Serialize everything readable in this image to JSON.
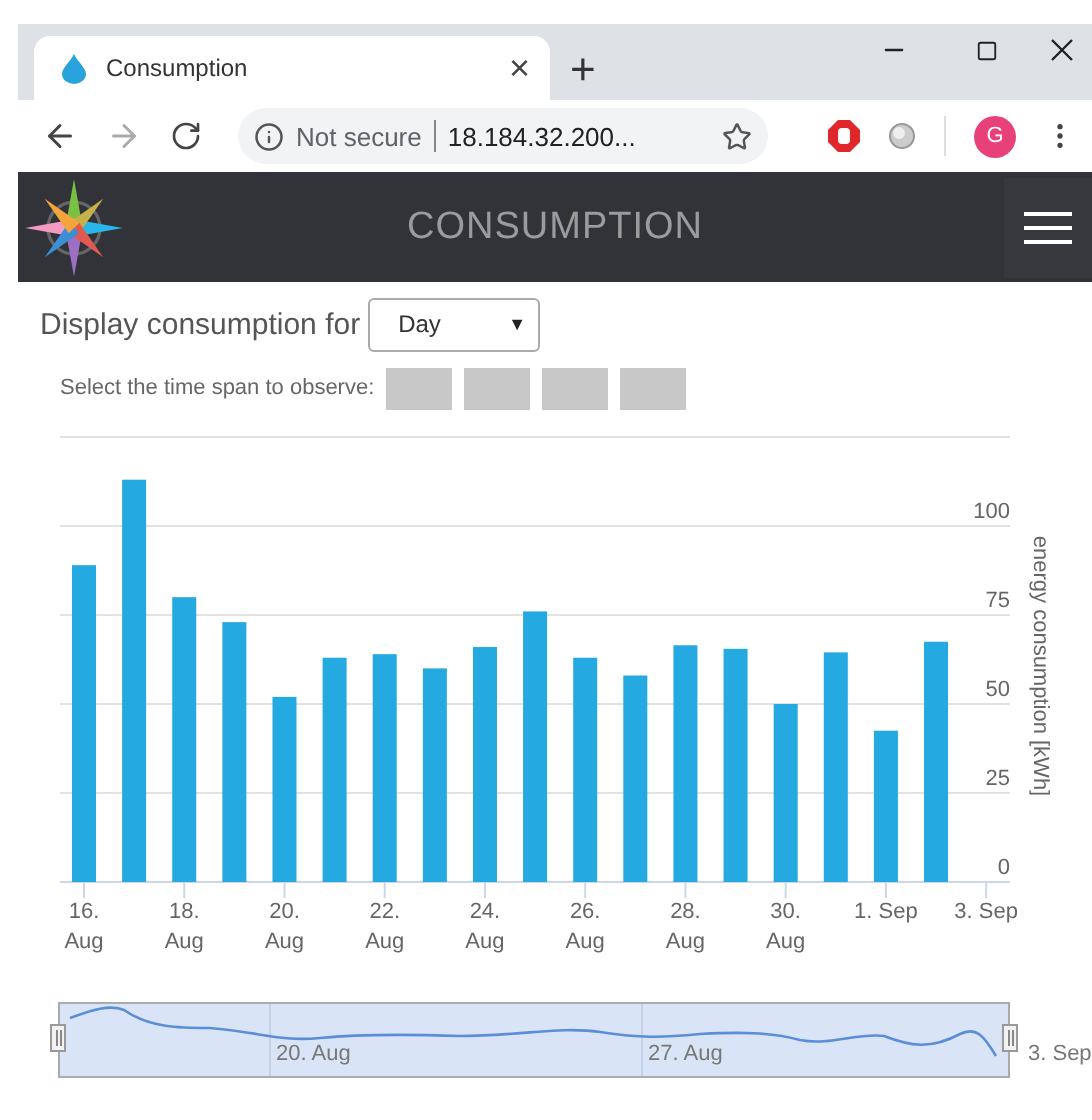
{
  "browser": {
    "tab": {
      "title": "Consumption",
      "close": "×"
    },
    "new_tab": "+",
    "security": "Not secure",
    "url": "18.184.32.200...",
    "profile": "G"
  },
  "app": {
    "title": "CONSUMPTION"
  },
  "controls": {
    "display_label": "Display consumption for",
    "period": "Day",
    "period_arrow": "▼",
    "span_label": "Select the time span to observe:"
  },
  "chart": {
    "chart_data": {
      "type": "bar",
      "ylabel": "energy consumption [kWh]",
      "categories": [
        "16.\nAug",
        null,
        "18.\nAug",
        null,
        "20.\nAug",
        null,
        "22.\nAug",
        null,
        "24.\nAug",
        null,
        "26.\nAug",
        null,
        "28.\nAug",
        null,
        "30.\nAug",
        null,
        "1. Sep",
        null,
        "3. Sep"
      ],
      "grid": true,
      "series": [
        {
          "color": "#24a9e1",
          "values": [
            89,
            113,
            80,
            73,
            52,
            63,
            64,
            60,
            66,
            76,
            63,
            58,
            66.5,
            65.5,
            50,
            64.5,
            42.5,
            67.5,
            null
          ]
        }
      ],
      "ylim": [
        0,
        125
      ],
      "yticks": [
        0,
        25,
        50,
        75,
        100
      ]
    }
  },
  "navigator": {
    "labels": [
      "20. Aug",
      "27. Aug",
      "3. Sep"
    ]
  }
}
